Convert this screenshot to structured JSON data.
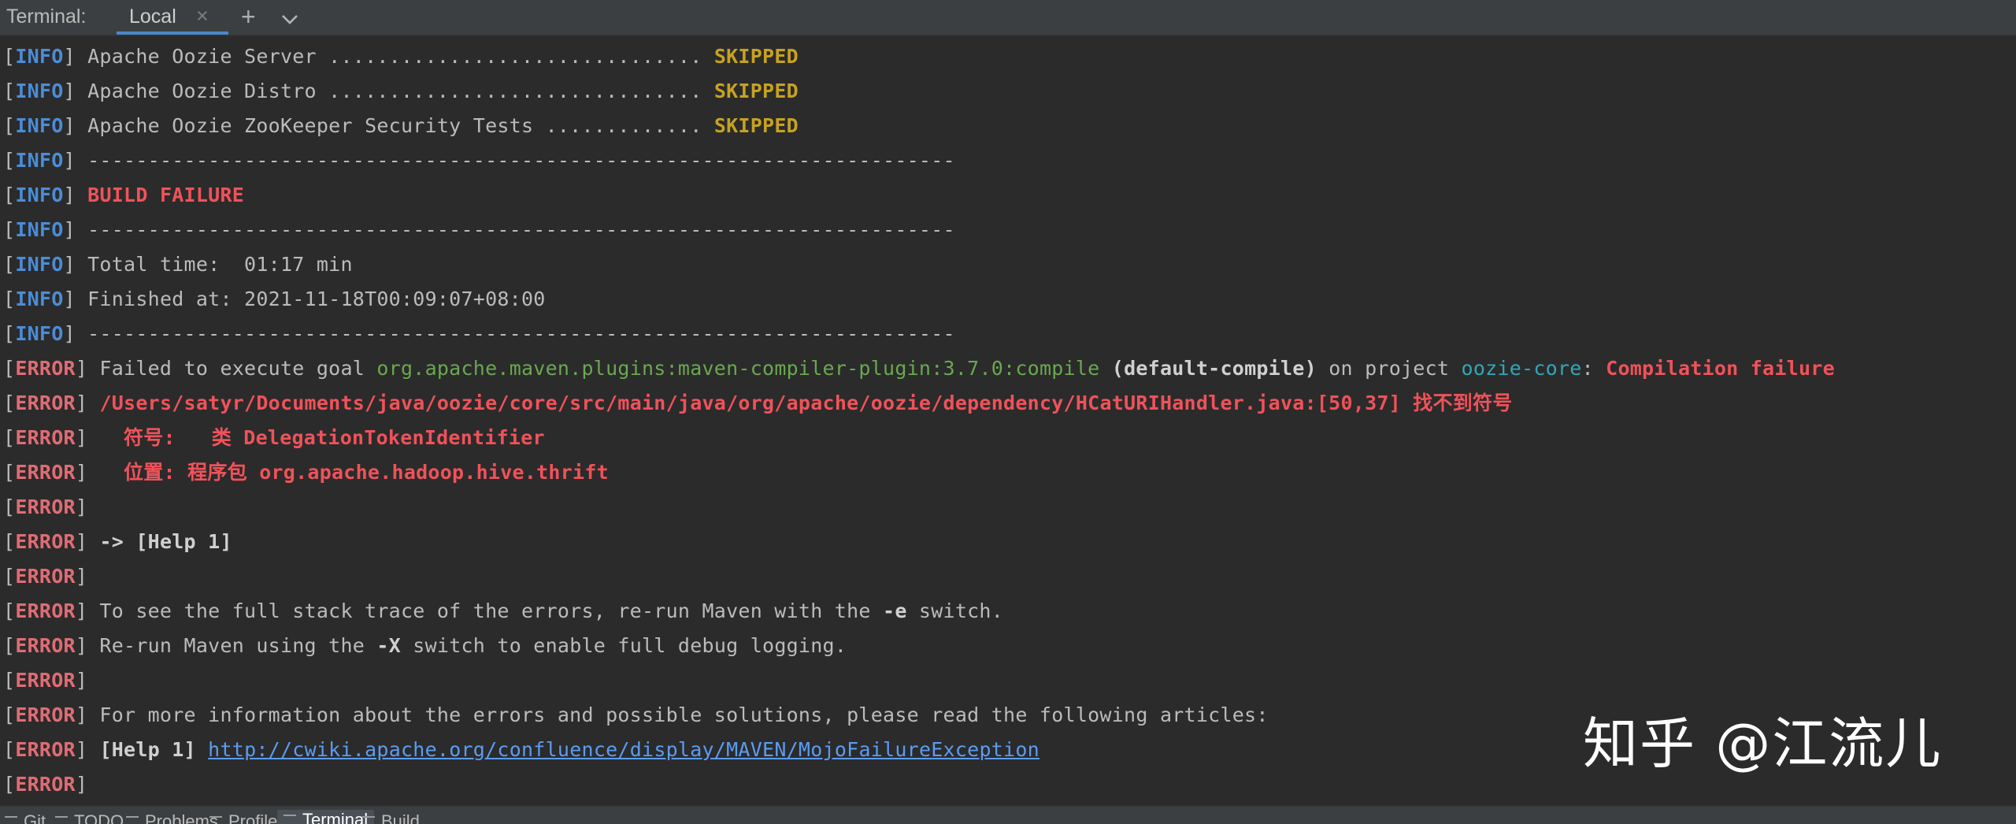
{
  "toolwindow": {
    "title": "Terminal:",
    "tab_label": "Local",
    "tab_close": "×",
    "add": "+",
    "chevron": "chevron-down-icon"
  },
  "lines": [
    [
      [
        "[",
        "br"
      ],
      [
        "INFO",
        "info"
      ],
      [
        "] Apache Oozie Server ............................... ",
        ""
      ],
      [
        "SKIPPED",
        "skip"
      ]
    ],
    [
      [
        "[",
        "br"
      ],
      [
        "INFO",
        "info"
      ],
      [
        "] Apache Oozie Distro ............................... ",
        ""
      ],
      [
        "SKIPPED",
        "skip"
      ]
    ],
    [
      [
        "[",
        "br"
      ],
      [
        "INFO",
        "info"
      ],
      [
        "] Apache Oozie ZooKeeper Security Tests ............. ",
        ""
      ],
      [
        "SKIPPED",
        "skip"
      ]
    ],
    [
      [
        "[",
        "br"
      ],
      [
        "INFO",
        "info"
      ],
      [
        "] ------------------------------------------------------------------------",
        ""
      ]
    ],
    [
      [
        "[",
        "br"
      ],
      [
        "INFO",
        "info"
      ],
      [
        "] ",
        ""
      ],
      [
        "BUILD FAILURE",
        "red"
      ]
    ],
    [
      [
        "[",
        "br"
      ],
      [
        "INFO",
        "info"
      ],
      [
        "] ------------------------------------------------------------------------",
        ""
      ]
    ],
    [
      [
        "[",
        "br"
      ],
      [
        "INFO",
        "info"
      ],
      [
        "] Total time:  01:17 min",
        ""
      ]
    ],
    [
      [
        "[",
        "br"
      ],
      [
        "INFO",
        "info"
      ],
      [
        "] Finished at: 2021-11-18T00:09:07+08:00",
        ""
      ]
    ],
    [
      [
        "[",
        "br"
      ],
      [
        "INFO",
        "info"
      ],
      [
        "] ------------------------------------------------------------------------",
        ""
      ]
    ],
    [
      [
        "[",
        "br"
      ],
      [
        "ERROR",
        "err"
      ],
      [
        "] Failed to execute goal ",
        ""
      ],
      [
        "org.apache.maven.plugins:maven-compiler-plugin:3.7.0:compile",
        "grn"
      ],
      [
        " ",
        ""
      ],
      [
        "(default-compile)",
        "wb"
      ],
      [
        " on project ",
        ""
      ],
      [
        "oozie-core",
        "cyan"
      ],
      [
        ": ",
        ""
      ],
      [
        "Compilation failure",
        "red"
      ]
    ],
    [
      [
        "[",
        "br"
      ],
      [
        "ERROR",
        "err"
      ],
      [
        "] ",
        ""
      ],
      [
        "/Users/satyr/Documents/java/oozie/core/src/main/java/org/apache/oozie/dependency/HCatURIHandler.java:[50,37] 找不到符号",
        "red"
      ]
    ],
    [
      [
        "[",
        "br"
      ],
      [
        "ERROR",
        "err"
      ],
      [
        "]   ",
        ""
      ],
      [
        "符号:   类 DelegationTokenIdentifier",
        "red"
      ]
    ],
    [
      [
        "[",
        "br"
      ],
      [
        "ERROR",
        "err"
      ],
      [
        "]   ",
        ""
      ],
      [
        "位置: 程序包 org.apache.hadoop.hive.thrift",
        "red"
      ]
    ],
    [
      [
        "[",
        "br"
      ],
      [
        "ERROR",
        "err"
      ],
      [
        "] ",
        ""
      ]
    ],
    [
      [
        "[",
        "br"
      ],
      [
        "ERROR",
        "err"
      ],
      [
        "] ",
        ""
      ],
      [
        "-> [Help 1]",
        "wb"
      ]
    ],
    [
      [
        "[",
        "br"
      ],
      [
        "ERROR",
        "err"
      ],
      [
        "] ",
        ""
      ]
    ],
    [
      [
        "[",
        "br"
      ],
      [
        "ERROR",
        "err"
      ],
      [
        "] To see the full stack trace of the errors, re-run Maven with the ",
        ""
      ],
      [
        "-e",
        "wb"
      ],
      [
        " switch.",
        ""
      ]
    ],
    [
      [
        "[",
        "br"
      ],
      [
        "ERROR",
        "err"
      ],
      [
        "] Re-run Maven using the ",
        ""
      ],
      [
        "-X",
        "wb"
      ],
      [
        " switch to enable full debug logging.",
        ""
      ]
    ],
    [
      [
        "[",
        "br"
      ],
      [
        "ERROR",
        "err"
      ],
      [
        "] ",
        ""
      ]
    ],
    [
      [
        "[",
        "br"
      ],
      [
        "ERROR",
        "err"
      ],
      [
        "] For more information about the errors and possible solutions, please read the following articles:",
        ""
      ]
    ],
    [
      [
        "[",
        "br"
      ],
      [
        "ERROR",
        "err"
      ],
      [
        "] ",
        ""
      ],
      [
        "[Help 1]",
        "wb"
      ],
      [
        " ",
        ""
      ],
      [
        "http://cwiki.apache.org/confluence/display/MAVEN/MojoFailureException",
        "link"
      ]
    ],
    [
      [
        "[",
        "br"
      ],
      [
        "ERROR",
        "err"
      ],
      [
        "] ",
        ""
      ]
    ]
  ],
  "watermark": "知乎 @江流儿",
  "bottom_tools": [
    {
      "label": "Git",
      "icon": "git-icon",
      "active": false
    },
    {
      "label": "TODO",
      "icon": "list-icon",
      "active": false
    },
    {
      "label": "Problems",
      "icon": "problems-icon",
      "active": false
    },
    {
      "label": "Profiler",
      "icon": "profiler-icon",
      "active": false
    },
    {
      "label": "Terminal",
      "icon": "terminal-icon",
      "active": true
    },
    {
      "label": "Build",
      "icon": "hammer-icon",
      "active": false
    }
  ]
}
